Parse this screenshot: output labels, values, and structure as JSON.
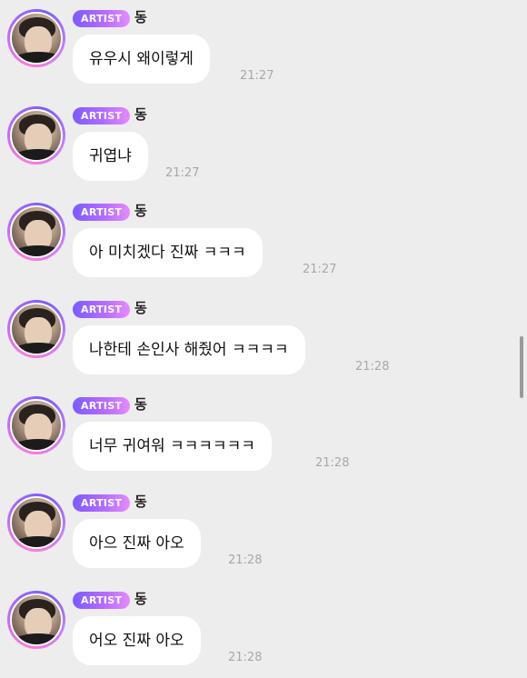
{
  "messages": [
    {
      "badge": "ARTIST",
      "sender": "동",
      "text": "유우시 왜이렇게",
      "time": "21:27"
    },
    {
      "badge": "ARTIST",
      "sender": "동",
      "text": "귀엽냐",
      "time": "21:27"
    },
    {
      "badge": "ARTIST",
      "sender": "동",
      "text": "아 미치겠다 진짜 ㅋㅋㅋ",
      "time": "21:27"
    },
    {
      "badge": "ARTIST",
      "sender": "동",
      "text": "나한테 손인사 해줬어 ㅋㅋㅋㅋ",
      "time": "21:28"
    },
    {
      "badge": "ARTIST",
      "sender": "동",
      "text": "너무 귀여워 ㅋㅋㅋㅋㅋㅋ",
      "time": "21:28"
    },
    {
      "badge": "ARTIST",
      "sender": "동",
      "text": "아으 진짜 아오",
      "time": "21:28"
    },
    {
      "badge": "ARTIST",
      "sender": "동",
      "text": "어오 진짜 아오",
      "time": "21:28"
    }
  ],
  "icons": {
    "avatar": "profile-photo"
  }
}
